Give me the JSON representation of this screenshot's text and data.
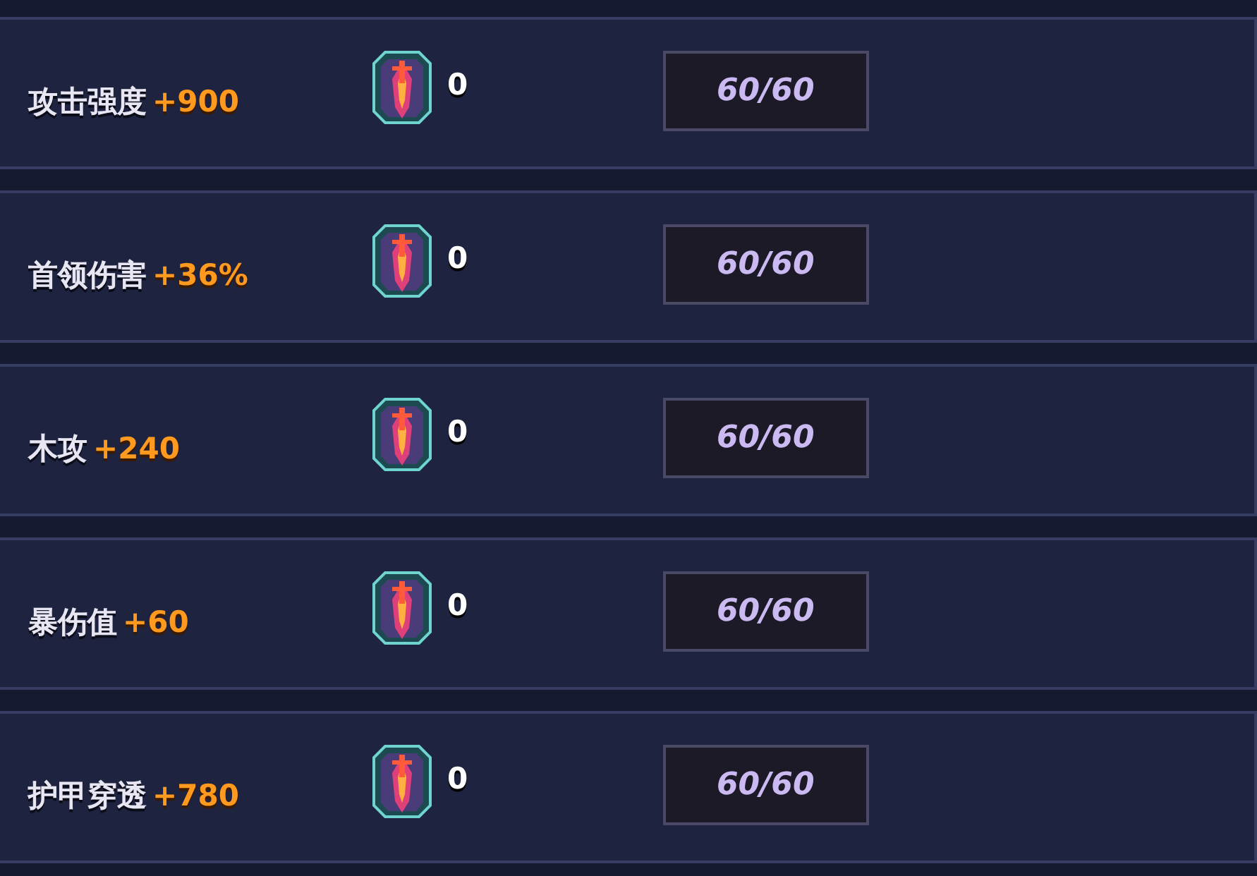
{
  "stats": [
    {
      "name": "攻击强度",
      "bonus": "+900",
      "count": "0",
      "progress": "60/60"
    },
    {
      "name": "首领伤害",
      "bonus": "+36%",
      "count": "0",
      "progress": "60/60"
    },
    {
      "name": "木攻",
      "bonus": "+240",
      "count": "0",
      "progress": "60/60"
    },
    {
      "name": "暴伤值",
      "bonus": "+60",
      "count": "0",
      "progress": "60/60"
    },
    {
      "name": "护甲穿透",
      "bonus": "+780",
      "count": "0",
      "progress": "60/60"
    }
  ]
}
